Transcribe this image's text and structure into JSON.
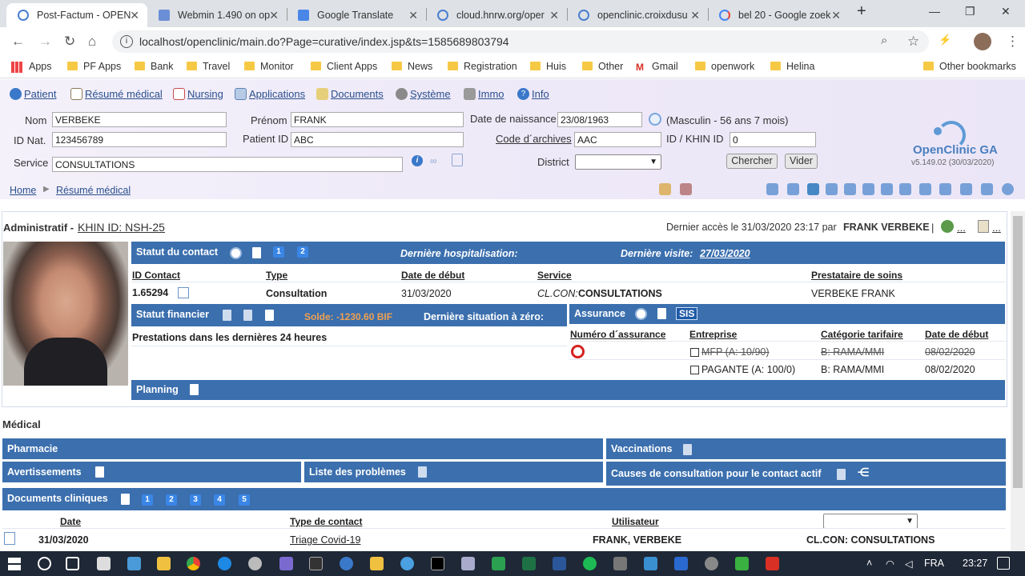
{
  "browser": {
    "tabs": [
      {
        "label": "Post-Factum - OPEN",
        "active": true,
        "icon": "openclinic-icon"
      },
      {
        "label": "Webmin 1.490 on op",
        "icon": "webmin-icon"
      },
      {
        "label": "Google Translate",
        "icon": "translate-icon"
      },
      {
        "label": "cloud.hnrw.org/oper",
        "icon": "openclinic-icon"
      },
      {
        "label": "openclinic.croixdusu",
        "icon": "openclinic-icon"
      },
      {
        "label": "bel 20 - Google zoek",
        "icon": "google-icon"
      }
    ],
    "url": "localhost/openclinic/main.do?Page=curative/index.jsp&ts=1585689803794",
    "bookmarks": [
      "Apps",
      "PF Apps",
      "Bank",
      "Travel",
      "Monitor",
      "Client Apps",
      "News",
      "Registration",
      "Huis",
      "Other",
      "Gmail",
      "openwork",
      "Helina",
      "Other bookmarks"
    ]
  },
  "menu": [
    {
      "label": "Patient",
      "icon": "patient-icon",
      "color": "#3a78c9"
    },
    {
      "label": "Résumé médical",
      "icon": "medical-summary-icon",
      "color": "#8c7a5a"
    },
    {
      "label": "Nursing",
      "icon": "nursing-icon",
      "color": "#c94a4a"
    },
    {
      "label": "Applications",
      "icon": "applications-icon",
      "color": "#5a86b5"
    },
    {
      "label": "Documents",
      "icon": "documents-icon",
      "color": "#c9a44a"
    },
    {
      "label": "Système",
      "icon": "system-icon",
      "color": "#6a6a6a"
    },
    {
      "label": "Immo",
      "icon": "immo-icon",
      "color": "#7a7a7a"
    },
    {
      "label": "Info",
      "icon": "info-icon",
      "color": "#3a78c9"
    }
  ],
  "search": {
    "nom_label": "Nom",
    "nom_value": "VERBEKE",
    "prenom_label": "Prénom",
    "prenom_value": "FRANK",
    "dob_label": "Date de naissance",
    "dob_value": "23/08/1963",
    "dob_info": "(Masculin - 56 ans 7 mois)",
    "idnat_label": "ID Nat.",
    "idnat_value": "123456789",
    "patientid_label": "Patient ID",
    "patientid_value": "ABC",
    "archives_label": "Code d´archives",
    "archives_value": "AAC",
    "khin_label": "ID / KHIN ID",
    "khin_value": "0",
    "service_label": "Service",
    "service_value": "CONSULTATIONS",
    "district_label": "District",
    "district_value": "",
    "search_button": "Chercher",
    "clear_button": "Vider"
  },
  "logo": {
    "name": "OpenClinic GA",
    "version": "v5.149.02 (30/03/2020)"
  },
  "breadcrumb": {
    "home": "Home",
    "current": "Résumé médical"
  },
  "admin": {
    "title": "Administratif -",
    "khin": "KHIN ID: NSH-25",
    "last_access": "Dernier accès le 31/03/2020 23:17 par",
    "last_user": "FRANK VERBEKE",
    "more": "..."
  },
  "contact": {
    "title": "Statut du contact",
    "badges": [
      "1",
      "2"
    ],
    "last_hosp_label": "Dernière hospitalisation:",
    "last_visit_label": "Dernière visite:",
    "last_visit_date": "27/03/2020",
    "headers": [
      "ID Contact",
      "Type",
      "Date de début",
      "Service",
      "Prestataire de soins"
    ],
    "row": {
      "id": "1.65294",
      "type": "Consultation",
      "start": "31/03/2020",
      "service_code": "CL.CON:",
      "service": "CONSULTATIONS",
      "provider": "VERBEKE FRANK"
    }
  },
  "financial": {
    "title": "Statut financier",
    "balance": "Solde: -1230.60 BIF",
    "zero_label": "Dernière situation à zéro:",
    "prestations": "Prestations dans les dernières 24 heures"
  },
  "insurance": {
    "title": "Assurance",
    "sis_label": "SIS",
    "headers": [
      "Numéro d´assurance",
      "Entreprise",
      "Catégorie tarifaire",
      "Date de début"
    ],
    "rows": [
      {
        "company": "MFP (A: 10/90)",
        "category": "B: RAMA/MMI",
        "start": "08/02/2020",
        "struck": true
      },
      {
        "company": "PAGANTE (A: 100/0)",
        "category": "B: RAMA/MMI",
        "start": "08/02/2020",
        "struck": false
      }
    ]
  },
  "planning": {
    "title": "Planning"
  },
  "medical": {
    "title": "Médical",
    "pharmacy": "Pharmacie",
    "vaccinations": "Vaccinations",
    "warnings": "Avertissements",
    "problems": "Liste des problèmes",
    "causes": "Causes de consultation pour le contact actif",
    "clinical_docs": "Documents cliniques",
    "doc_badges": [
      "1",
      "2",
      "3",
      "4",
      "5"
    ],
    "doc_headers": [
      "Date",
      "Type de contact",
      "Utilisateur"
    ],
    "doc_row": {
      "date": "31/03/2020",
      "type": "Triage Covid-19",
      "user": "FRANK, VERBEKE",
      "service": "CL.CON: CONSULTATIONS"
    }
  },
  "taskbar": {
    "lang": "FRA",
    "time": "23:27"
  }
}
